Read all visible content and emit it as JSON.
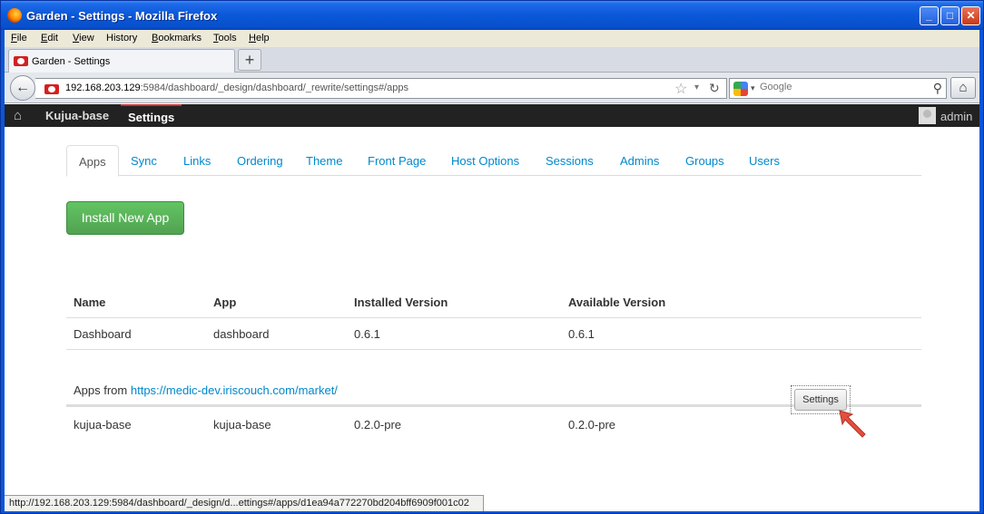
{
  "window": {
    "title": "Garden - Settings - Mozilla Firefox",
    "minimize": "_",
    "maximize": "□",
    "close": "✕"
  },
  "menu": [
    {
      "key": "F",
      "rest": "ile"
    },
    {
      "key": "E",
      "rest": "dit"
    },
    {
      "key": "V",
      "rest": "iew"
    },
    {
      "key": "",
      "rest": "History"
    },
    {
      "key": "B",
      "rest": "ookmarks"
    },
    {
      "key": "T",
      "rest": "ools"
    },
    {
      "key": "H",
      "rest": "elp"
    }
  ],
  "browser_tab": {
    "label": "Garden - Settings",
    "new_tab": "+"
  },
  "nav": {
    "back": "←",
    "url_host": "192.168.203.129",
    "url_rest": ":5984/dashboard/_design/dashboard/_rewrite/settings#/apps",
    "star": "☆",
    "dropdown": "▾",
    "reload": "↻",
    "search_placeholder": "Google",
    "search_dropdown": "▾",
    "search_icon": "⚲",
    "home": "⌂"
  },
  "garden": {
    "home_icon": "⌂",
    "project": "Kujua-base",
    "current": "Settings",
    "user": "admin"
  },
  "tabs": [
    "Apps",
    "Sync",
    "Links",
    "Ordering",
    "Theme",
    "Front Page",
    "Host Options",
    "Sessions",
    "Admins",
    "Groups",
    "Users"
  ],
  "install_button": "Install New App",
  "table": {
    "headers": [
      "Name",
      "App",
      "Installed Version",
      "Available Version"
    ],
    "installed": [
      {
        "name": "Dashboard",
        "app": "dashboard",
        "installed": "0.6.1",
        "available": "0.6.1"
      }
    ]
  },
  "market": {
    "prefix": "Apps from ",
    "link": "https://medic-dev.iriscouch.com/market/",
    "apps": [
      {
        "name": "kujua-base",
        "app": "kujua-base",
        "installed": "0.2.0-pre",
        "available": "0.2.0-pre",
        "button": "Settings"
      }
    ]
  },
  "status_text": "http://192.168.203.129:5984/dashboard/_design/d...ettings#/apps/d1ea94a772270bd204bff6909f001c02",
  "colors": {
    "link": "#0088cc",
    "install_green": "#51a351",
    "topbar": "#222222",
    "cursor": "#e05040"
  }
}
